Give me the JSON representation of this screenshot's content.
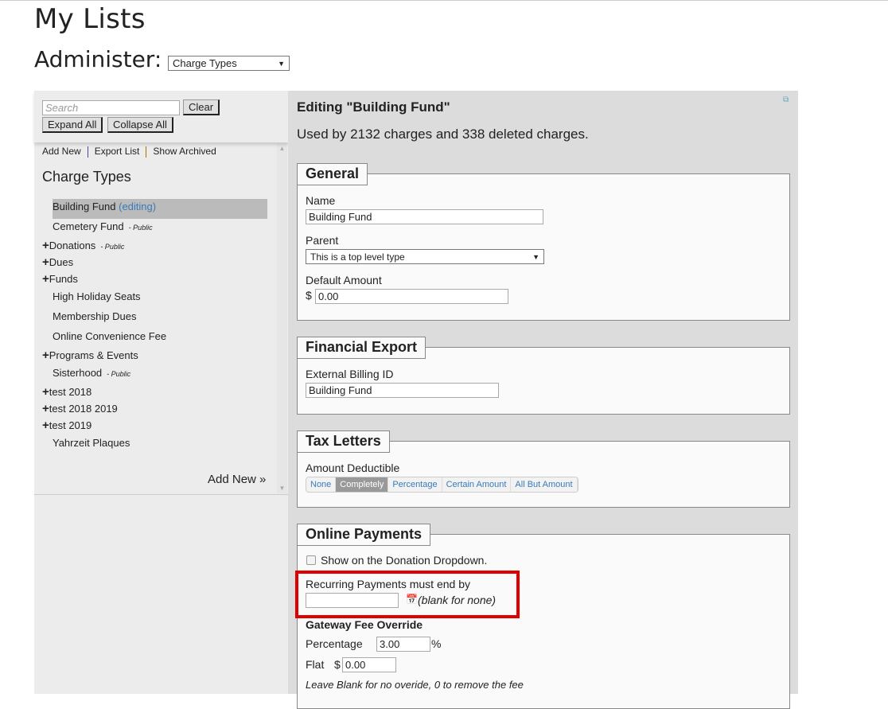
{
  "page": {
    "title": "My Lists",
    "administer_label": "Administer:",
    "administer_value": "Charge Types"
  },
  "sidebar": {
    "search_placeholder": "Search",
    "clear": "Clear",
    "expand_all": "Expand All",
    "collapse_all": "Collapse All",
    "links": [
      "Add New",
      "Export List",
      "Show Archived"
    ],
    "heading": "Charge Types",
    "items": [
      {
        "label": "Building Fund",
        "note": "(editing)",
        "public": "",
        "expandable": false
      },
      {
        "label": "Cemetery Fund",
        "public": "- Public",
        "expandable": false
      },
      {
        "label": "Donations",
        "public": "- Public",
        "expandable": true
      },
      {
        "label": "Dues",
        "public": "",
        "expandable": true
      },
      {
        "label": "Funds",
        "public": "",
        "expandable": true
      },
      {
        "label": "High Holiday Seats",
        "public": "",
        "expandable": false
      },
      {
        "label": "Membership Dues",
        "public": "",
        "expandable": false
      },
      {
        "label": "Online Convenience Fee",
        "public": "",
        "expandable": false
      },
      {
        "label": "Programs & Events",
        "public": "",
        "expandable": true
      },
      {
        "label": "Sisterhood",
        "public": "- Public",
        "expandable": false
      },
      {
        "label": "test 2018",
        "public": "",
        "expandable": true
      },
      {
        "label": "test 2018 2019",
        "public": "",
        "expandable": true
      },
      {
        "label": "test 2019",
        "public": "",
        "expandable": true
      },
      {
        "label": "Yahrzeit Plaques",
        "public": "",
        "expandable": false
      }
    ],
    "add_new": "Add New »"
  },
  "editor": {
    "title": "Editing \"Building Fund\"",
    "usage": "Used by 2132 charges and 338 deleted charges.",
    "general": {
      "legend": "General",
      "name_label": "Name",
      "name_value": "Building Fund",
      "parent_label": "Parent",
      "parent_value": "This is a top level type",
      "amount_label": "Default Amount",
      "currency": "$",
      "amount_value": "0.00"
    },
    "export": {
      "legend": "Financial Export",
      "id_label": "External Billing ID",
      "id_value": "Building Fund"
    },
    "tax": {
      "legend": "Tax Letters",
      "label": "Amount Deductible",
      "options": [
        "None",
        "Completely",
        "Percentage",
        "Certain Amount",
        "All But Amount"
      ],
      "selected": "Completely"
    },
    "online": {
      "legend": "Online Payments",
      "dropdown_label": "Show on the Donation Dropdown.",
      "dropdown_checked": false,
      "recurring_label": "Recurring Payments must end by",
      "recurring_value": "",
      "recurring_hint": "(blank for none)",
      "gateway_heading": "Gateway Fee Override",
      "percentage_label": "Percentage",
      "percentage_value": "3.00",
      "percent_sign": "%",
      "flat_label": "Flat",
      "flat_currency": "$",
      "flat_value": "0.00",
      "note": "Leave Blank for no overide, 0 to remove the fee"
    }
  },
  "colors": {
    "highlight": "#e00000",
    "link": "#3a7ab8",
    "selected_bg": "#bbbbbb"
  }
}
